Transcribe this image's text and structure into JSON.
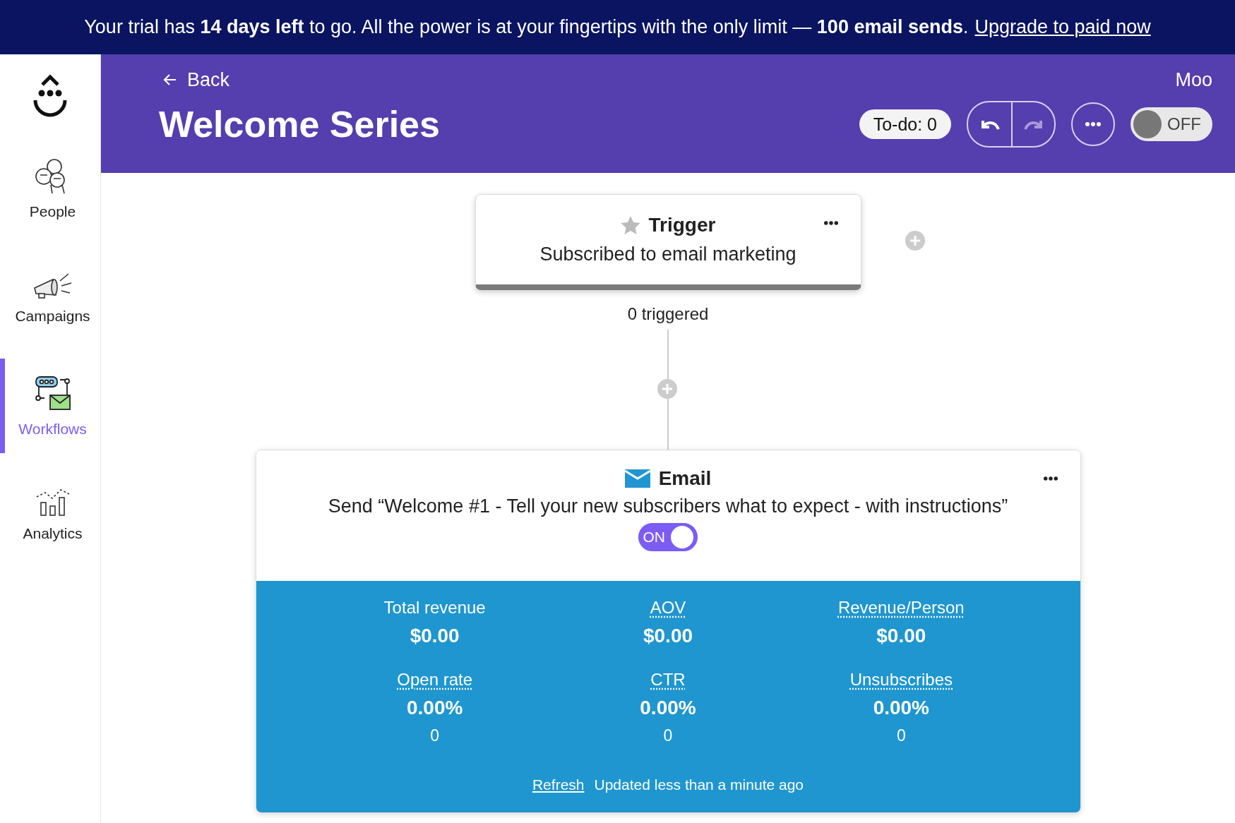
{
  "banner": {
    "text": "Your trial has **14 days left** to go. All the power is at your fingertips with the only limit — **100 email sends**.",
    "link": "Upgrade to paid now"
  },
  "sidebar": {
    "items": [
      {
        "label": "People",
        "kind": "people",
        "selected": false
      },
      {
        "label": "Campaigns",
        "kind": "campaigns",
        "selected": false
      },
      {
        "label": "Workflows",
        "kind": "workflows",
        "selected": true
      },
      {
        "label": "Analytics",
        "kind": "analytics",
        "selected": false
      }
    ]
  },
  "header": {
    "back": "Back",
    "account": "Moo",
    "title": "Welcome Series",
    "todo": "To-do: 0",
    "undo": {
      "disabled": false
    },
    "redo": {
      "disabled": true
    },
    "workflow_toggle": {
      "on": false,
      "label": "OFF"
    }
  },
  "trigger": {
    "title": "Trigger",
    "subtitle": "Subscribed to email marketing",
    "count": "0 triggered"
  },
  "email": {
    "title": "Email",
    "description": "Send “Welcome #1 - Tell your new subscribers what to expect - with instructions”",
    "toggle": {
      "on": true,
      "label": "ON"
    },
    "metrics": [
      {
        "label": "Total revenue",
        "underlined": false,
        "value": "$0.00"
      },
      {
        "label": "AOV",
        "underlined": true,
        "value": "$0.00"
      },
      {
        "label": "Revenue/Person",
        "underlined": true,
        "value": "$0.00"
      },
      {
        "label": "Open rate",
        "underlined": true,
        "value": "0.00%",
        "count": "0"
      },
      {
        "label": "CTR",
        "underlined": true,
        "value": "0.00%",
        "count": "0"
      },
      {
        "label": "Unsubscribes",
        "underlined": true,
        "value": "0.00%",
        "count": "0"
      }
    ],
    "refresh": "Refresh",
    "updated": "Updated less than a minute ago"
  }
}
